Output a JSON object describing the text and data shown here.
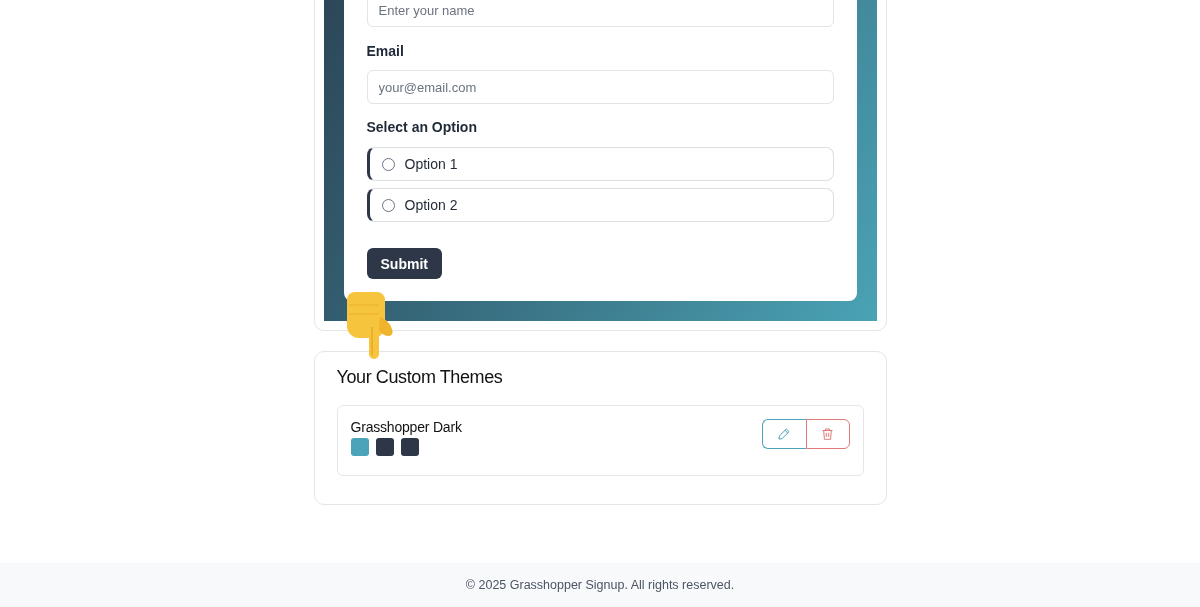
{
  "form": {
    "fields": [
      {
        "placeholder": "Enter your name"
      },
      {
        "label": "Email",
        "placeholder": "your@email.com"
      }
    ],
    "radio_group": {
      "label": "Select an Option",
      "options": [
        {
          "label": "Option 1",
          "selected": false
        },
        {
          "label": "Option 2",
          "selected": false
        }
      ]
    },
    "submit_button": "Submit"
  },
  "themes": {
    "title": "Your Custom Themes",
    "items": [
      {
        "name": "Grasshopper Dark",
        "swatches": [
          {
            "color": "#4aa3b8"
          },
          {
            "color": "#2d3748"
          },
          {
            "color": "#2d3748"
          }
        ]
      }
    ]
  },
  "footer": {
    "text": "© 2025 Grasshopper Signup. All rights reserved."
  }
}
